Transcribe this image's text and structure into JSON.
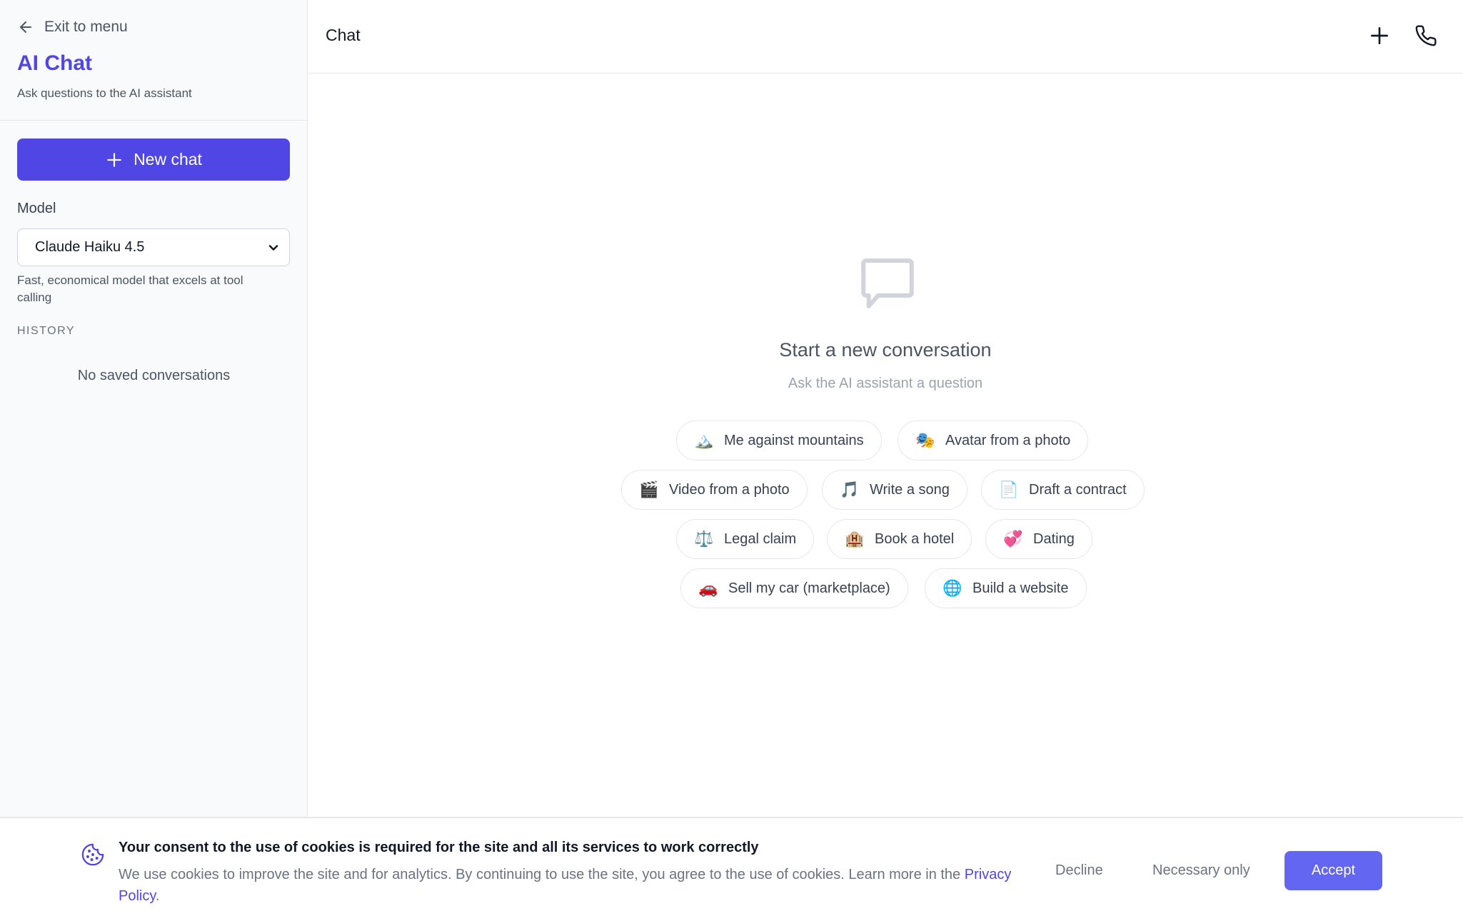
{
  "sidebar": {
    "exit_label": "Exit to menu",
    "title": "AI Chat",
    "subtitle": "Ask questions to the AI assistant",
    "new_chat_label": "New chat",
    "model_label": "Model",
    "model_selected": "Claude Haiku 4.5",
    "model_description": "Fast, economical model that excels at tool calling",
    "history_label": "HISTORY",
    "history_empty": "No saved conversations"
  },
  "header": {
    "title": "Chat",
    "actions": [
      "plus-icon",
      "phone-icon"
    ]
  },
  "empty_state": {
    "icon": "chat-bubble-icon",
    "title": "Start a new conversation",
    "subtitle": "Ask the AI assistant a question"
  },
  "suggestions": [
    {
      "emoji": "🏔️",
      "label": "Me against mountains"
    },
    {
      "emoji": "🎭",
      "label": "Avatar from a photo"
    },
    {
      "emoji": "🎬",
      "label": "Video from a photo"
    },
    {
      "emoji": "🎵",
      "label": "Write a song"
    },
    {
      "emoji": "📄",
      "label": "Draft a contract"
    },
    {
      "emoji": "⚖️",
      "label": "Legal claim"
    },
    {
      "emoji": "🏨",
      "label": "Book a hotel"
    },
    {
      "emoji": "💞",
      "label": "Dating"
    },
    {
      "emoji": "🚗",
      "label": "Sell my car (marketplace)"
    },
    {
      "emoji": "🌐",
      "label": "Build a website"
    }
  ],
  "cookie": {
    "title": "Your consent to the use of cookies is required for the site and all its services to work correctly",
    "text": "We use cookies to improve the site and for analytics. By continuing to use the site, you agree to the use of cookies. Learn more in the",
    "link": "Privacy Policy",
    "decline": "Decline",
    "necessary": "Necessary only",
    "accept": "Accept"
  },
  "colors": {
    "accent": "#4f46e5",
    "accept_button": "#6366f1",
    "sidebar_bg": "#f9fafb"
  }
}
